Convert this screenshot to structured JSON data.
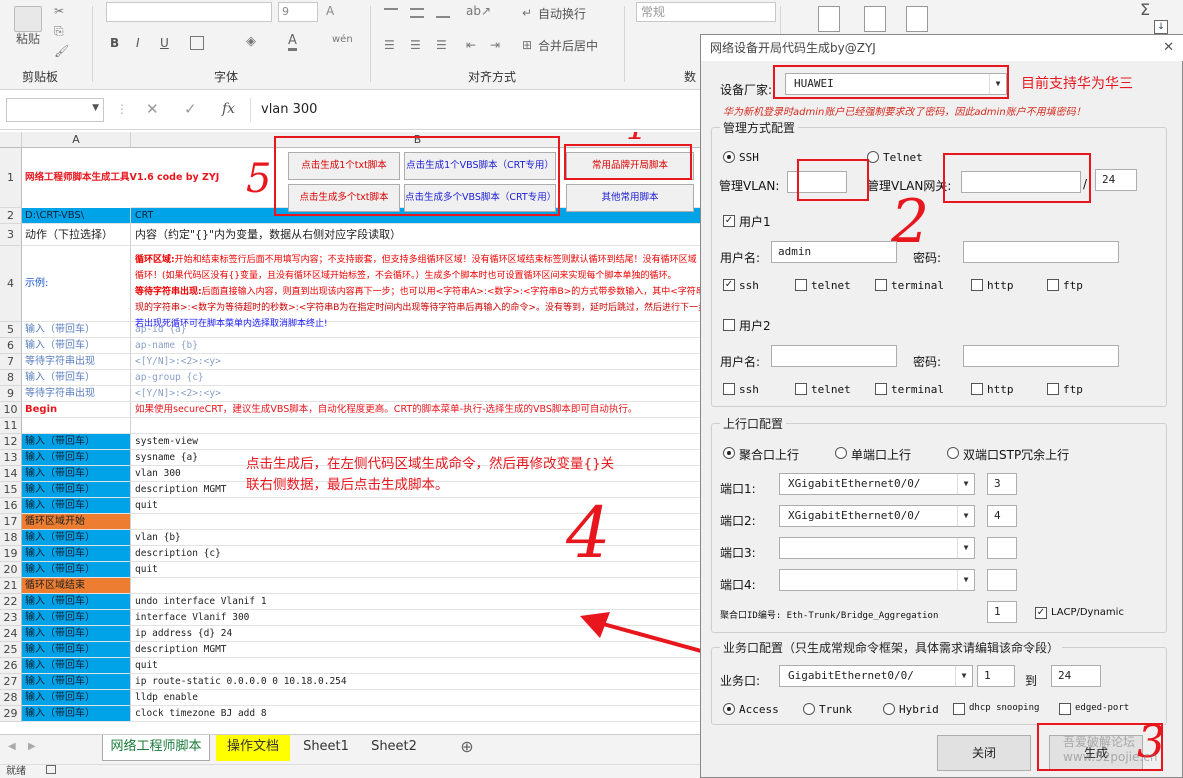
{
  "ribbon": {
    "paste_label": "粘贴",
    "clipboard_label": "剪贴板",
    "font_group_label": "字体",
    "font_size": "9",
    "bold": "B",
    "italic": "I",
    "underline": "U",
    "align_group_label": "对齐方式",
    "wrap_text": "自动换行",
    "merge_center": "合并后居中",
    "number_group_label": "数",
    "number_format": "常规"
  },
  "formula_bar": {
    "name_box": "",
    "fx": "fx",
    "formula": "vlan 300"
  },
  "columns": {
    "a": "A",
    "b": "B"
  },
  "excel_buttons": {
    "gen_one_txt": "点击生成1个txt脚本",
    "gen_one_vbs": "点击生成1个VBS脚本（CRT专用）",
    "gen_many_txt": "点击生成多个txt脚本",
    "gen_many_vbs": "点击生成多个VBS脚本（CRT专用）",
    "common_brand": "常用品牌开局脚本",
    "other_common": "其他常用脚本"
  },
  "rows": [
    {
      "n": "1",
      "a": "网络工程师脚本生成工具V1.6  code by ZYJ",
      "b": ""
    },
    {
      "n": "2",
      "a": "D:\\CRT-VBS\\",
      "b": "CRT"
    },
    {
      "n": "3",
      "a": "动作（下拉选择）",
      "b": "内容（约定\"{}\"内为变量，数据从右侧对应字段读取）"
    },
    {
      "n": "4",
      "a": "示例:",
      "b": ""
    },
    {
      "n": "5",
      "a": "输入（带回车）",
      "b": "ap-id {a}"
    },
    {
      "n": "6",
      "a": "输入（带回车）",
      "b": "ap-name {b}"
    },
    {
      "n": "7",
      "a": "等待字符串出现",
      "b": "<[Y/N]>:<2>:<y>"
    },
    {
      "n": "8",
      "a": "输入（带回车）",
      "b": "ap-group {c}"
    },
    {
      "n": "9",
      "a": "等待字符串出现",
      "b": "<[Y/N]>:<2>:<y>"
    },
    {
      "n": "10",
      "a": "Begin",
      "b": "如果使用secureCRT，建议生成VBS脚本，自动化程度更高。CRT的脚本菜单-执行-选择生成的VBS脚本即可自动执行。"
    },
    {
      "n": "11",
      "a": "",
      "b": ""
    },
    {
      "n": "12",
      "a": "输入（带回车）",
      "b": "system-view"
    },
    {
      "n": "13",
      "a": "输入（带回车）",
      "b": "sysname {a}"
    },
    {
      "n": "14",
      "a": "输入（带回车）",
      "b": "vlan 300"
    },
    {
      "n": "15",
      "a": "输入（带回车）",
      "b": "description MGMT"
    },
    {
      "n": "16",
      "a": "输入（带回车）",
      "b": "quit"
    },
    {
      "n": "17",
      "a": "循环区域开始",
      "b": ""
    },
    {
      "n": "18",
      "a": "输入（带回车）",
      "b": "vlan {b}"
    },
    {
      "n": "19",
      "a": "输入（带回车）",
      "b": "description {c}"
    },
    {
      "n": "20",
      "a": "输入（带回车）",
      "b": "quit"
    },
    {
      "n": "21",
      "a": "循环区域结束",
      "b": ""
    },
    {
      "n": "22",
      "a": "输入（带回车）",
      "b": "undo interface Vlanif 1"
    },
    {
      "n": "23",
      "a": "输入（带回车）",
      "b": "interface Vlanif 300"
    },
    {
      "n": "24",
      "a": "输入（带回车）",
      "b": "ip address {d} 24"
    },
    {
      "n": "25",
      "a": "输入（带回车）",
      "b": "description MGMT"
    },
    {
      "n": "26",
      "a": "输入（带回车）",
      "b": "quit"
    },
    {
      "n": "27",
      "a": "输入（带回车）",
      "b": "ip route-static 0.0.0.0 0 10.18.0.254"
    },
    {
      "n": "28",
      "a": "输入（带回车）",
      "b": "lldp enable"
    },
    {
      "n": "29",
      "a": "输入（带回车）",
      "b": "clock timezone BJ add 8"
    }
  ],
  "example_text": {
    "line1a": "循环区域:",
    "line1b": "开始和结束标签行后面不用填写内容；不支持嵌套，但支持多组循环区域！没有循环区域结束标签则默认循环到结尾！没有循环区域",
    "line2": "循环！(如果代码区没有{}变量，且没有循环区域开始标签，不会循环。）生成多个脚本时也可设置循环区间来实现每个脚本单独的循环。",
    "line3a": "等待字符串出现:",
    "line3b": "后面直接输入内容，则直到出现该内容再下一步；也可以用<字符串A>:<数字>:<字符串B>的方式带参数输入，其中<字符串",
    "line4": "现的字符串>:<数字为等待超时的秒数>:<字符串B为在指定时间内出现等待字符串后再输入的命令>。没有等到，延时后跳过，然后进行下一步",
    "line5": "若出现死循环可在脚本菜单内选择取消脚本终止!"
  },
  "sheet_tabs": [
    "网络工程师脚本",
    "操作文档",
    "Sheet1",
    "Sheet2"
  ],
  "add_sheet": "⊕",
  "status_text": "就绪",
  "annotation_text": "点击生成后，在左侧代码区域生成命令，然后再修改变量{}关联右侧数据，最后点击生成脚本。",
  "dialog": {
    "title": "网络设备开局代码生成by@ZYJ",
    "close": "✕",
    "vendor_label": "设备厂家:",
    "vendor_value": "HUAWEI",
    "vendor_note": "目前支持华为华三",
    "huawei_warning": "华为新机登录时admin账户已经强制要求改了密码，因此admin账户不用填密码！",
    "mgmt_section": "管理方式配置",
    "ssh": "SSH",
    "telnet": "Telnet",
    "mgmt_vlan_label": "管理VLAN:",
    "mgmt_vlan_value": "",
    "mgmt_gw_label": "管理VLAN网关:",
    "mgmt_gw_value": "",
    "mask_sep": "/",
    "mask_value": "24",
    "user1": "用户1",
    "user2": "用户2",
    "username_label": "用户名:",
    "password_label": "密码:",
    "user1_name": "admin",
    "svc": [
      "ssh",
      "telnet",
      "terminal",
      "http",
      "ftp"
    ],
    "uplink_section": "上行口配置",
    "agg_uplink": "聚合口上行",
    "single_uplink": "单端口上行",
    "dual_stp": "双端口STP冗余上行",
    "port_labels": [
      "端口1:",
      "端口2:",
      "端口3:",
      "端口4:"
    ],
    "port_values": [
      "XGigabitEthernet0/0/",
      "XGigabitEthernet0/0/",
      "",
      ""
    ],
    "port_nums": [
      "3",
      "4",
      "",
      ""
    ],
    "agg_id_label": "聚合口ID编号: Eth-Trunk/Bridge_Aggregation",
    "agg_id": "1",
    "lacp": "LACP/Dynamic",
    "biz_section": "业务口配置（只生成常规命令框架，具体需求请编辑该命令段）",
    "biz_label": "业务口:",
    "biz_port": "GigabitEthernet0/0/",
    "biz_from": "1",
    "biz_to_label": "到",
    "biz_to": "24",
    "access": "Access",
    "trunk": "Trunk",
    "hybrid": "Hybrid",
    "dhcp": "dhcp snooping",
    "edged": "edged-port",
    "btn_close": "关闭",
    "btn_gen": "生成"
  },
  "handwritten": {
    "n1": "1",
    "n2": "2",
    "n3": "3",
    "n4": "4",
    "n5": "5"
  },
  "watermark": "吾爱破解论坛 www.52pojie.cn",
  "colors": {
    "accent_red": "#e8161d",
    "cell_blue": "#00a2e8",
    "cell_orange": "#ed7d31"
  }
}
